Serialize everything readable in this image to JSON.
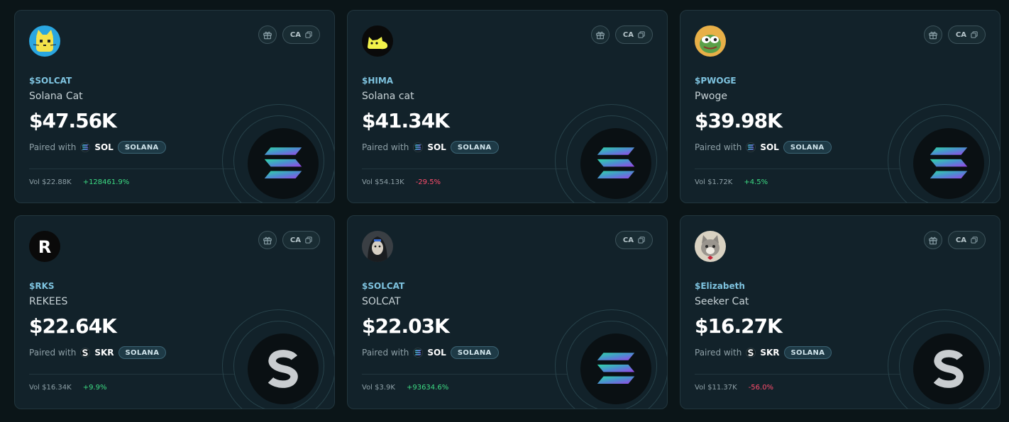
{
  "labels": {
    "paired_with": "Paired with",
    "ca": "CA"
  },
  "colors": {
    "positive": "#3ddc84",
    "negative": "#ff4d6d",
    "ticker": "#7ec3df"
  },
  "cards": [
    {
      "avatar": "solcat-icon",
      "ticker": "$SOLCAT",
      "name": "Solana Cat",
      "mcap": "$47.56K",
      "pair": "SOL",
      "pair_icon": "solana-icon",
      "chain": "SOLANA",
      "vol": "Vol $22.88K",
      "change": "+128461.9%",
      "change_dir": "pos",
      "has_gift": true
    },
    {
      "avatar": "hima-icon",
      "ticker": "$HIMA",
      "name": "Solana cat",
      "mcap": "$41.34K",
      "pair": "SOL",
      "pair_icon": "solana-icon",
      "chain": "SOLANA",
      "vol": "Vol $54.13K",
      "change": "-29.5%",
      "change_dir": "neg",
      "has_gift": true
    },
    {
      "avatar": "pwoge-icon",
      "ticker": "$PWOGE",
      "name": "Pwoge",
      "mcap": "$39.98K",
      "pair": "SOL",
      "pair_icon": "solana-icon",
      "chain": "SOLANA",
      "vol": "Vol $1.72K",
      "change": "+4.5%",
      "change_dir": "pos",
      "has_gift": true
    },
    {
      "avatar": "rks-icon",
      "avatar_letter": "R",
      "ticker": "$RKS",
      "name": "REKEES",
      "mcap": "$22.64K",
      "pair": "SKR",
      "pair_icon": "seeker-icon",
      "chain": "SOLANA",
      "vol": "Vol $16.34K",
      "change": "+9.9%",
      "change_dir": "pos",
      "has_gift": true
    },
    {
      "avatar": "solcat-hooded-icon",
      "ticker": "$SOLCAT",
      "name": "SOLCAT",
      "mcap": "$22.03K",
      "pair": "SOL",
      "pair_icon": "solana-icon",
      "chain": "SOLANA",
      "vol": "Vol $3.9K",
      "change": "+93634.6%",
      "change_dir": "pos",
      "has_gift": false
    },
    {
      "avatar": "elizabeth-cat-icon",
      "ticker": "$Elizabeth",
      "name": "Seeker Cat",
      "mcap": "$16.27K",
      "pair": "SKR",
      "pair_icon": "seeker-icon",
      "chain": "SOLANA",
      "vol": "Vol $11.37K",
      "change": "-56.0%",
      "change_dir": "neg",
      "has_gift": true
    }
  ]
}
